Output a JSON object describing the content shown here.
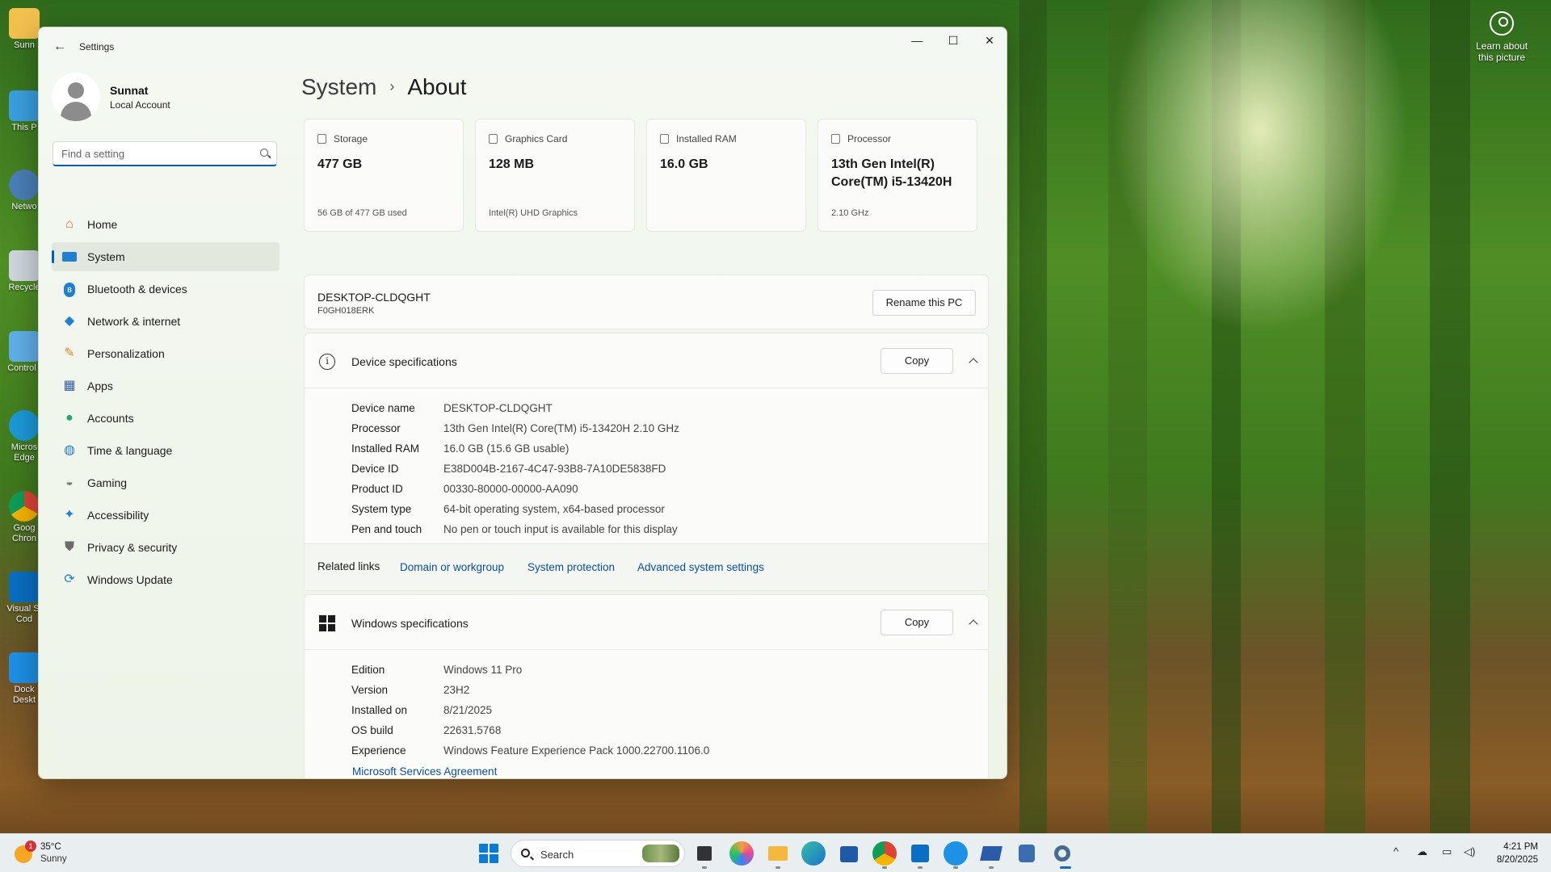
{
  "desktop": {
    "icons": [
      {
        "label": "Sunn"
      },
      {
        "label": "This P"
      },
      {
        "label": "Netwo"
      },
      {
        "label": "Recycle"
      },
      {
        "label": "Control I"
      },
      {
        "label": "Micros Edge"
      },
      {
        "label": "Goog Chron"
      },
      {
        "label": "Visual St Cod"
      },
      {
        "label": "Dock Deskt"
      }
    ],
    "learn_label": "Learn about this picture"
  },
  "window": {
    "title": "Settings",
    "minimize": "—",
    "maximize": "☐",
    "close": "✕"
  },
  "profile": {
    "name": "Sunnat",
    "account_type": "Local Account"
  },
  "search": {
    "placeholder": "Find a setting"
  },
  "nav": {
    "items": [
      {
        "label": "Home",
        "icon": "home-icon"
      },
      {
        "label": "System",
        "icon": "system-icon"
      },
      {
        "label": "Bluetooth & devices",
        "icon": "bluetooth-icon"
      },
      {
        "label": "Network & internet",
        "icon": "network-icon"
      },
      {
        "label": "Personalization",
        "icon": "brush-icon"
      },
      {
        "label": "Apps",
        "icon": "apps-icon"
      },
      {
        "label": "Accounts",
        "icon": "accounts-icon"
      },
      {
        "label": "Time & language",
        "icon": "globe-clock-icon"
      },
      {
        "label": "Gaming",
        "icon": "controller-icon"
      },
      {
        "label": "Accessibility",
        "icon": "accessibility-icon"
      },
      {
        "label": "Privacy & security",
        "icon": "shield-icon"
      },
      {
        "label": "Windows Update",
        "icon": "update-icon"
      }
    ],
    "active_index": 1
  },
  "breadcrumb": {
    "parent": "System",
    "separator": "›",
    "current": "About"
  },
  "cards": [
    {
      "label": "Storage",
      "value": "477 GB",
      "sub": "56 GB of 477 GB used"
    },
    {
      "label": "Graphics Card",
      "value": "128 MB",
      "sub": "Intel(R) UHD Graphics"
    },
    {
      "label": "Installed RAM",
      "value": "16.0 GB",
      "sub": ""
    },
    {
      "label": "Processor",
      "value": "13th Gen Intel(R) Core(TM) i5-13420H",
      "sub": "2.10 GHz"
    }
  ],
  "pc": {
    "name": "DESKTOP-CLDQGHT",
    "model": "F0GH018ERK",
    "rename_label": "Rename this PC"
  },
  "device_specs": {
    "title": "Device specifications",
    "copy_label": "Copy",
    "rows": [
      {
        "key": "Device name",
        "value": "DESKTOP-CLDQGHT"
      },
      {
        "key": "Processor",
        "value": "13th Gen Intel(R) Core(TM) i5-13420H   2.10 GHz"
      },
      {
        "key": "Installed RAM",
        "value": "16.0 GB (15.6 GB usable)"
      },
      {
        "key": "Device ID",
        "value": "E38D004B-2167-4C47-93B8-7A10DE5838FD"
      },
      {
        "key": "Product ID",
        "value": "00330-80000-00000-AA090"
      },
      {
        "key": "System type",
        "value": "64-bit operating system, x64-based processor"
      },
      {
        "key": "Pen and touch",
        "value": "No pen or touch input is available for this display"
      }
    ]
  },
  "related": {
    "label": "Related links",
    "links": [
      "Domain or workgroup",
      "System protection",
      "Advanced system settings"
    ]
  },
  "windows_specs": {
    "title": "Windows specifications",
    "copy_label": "Copy",
    "rows": [
      {
        "key": "Edition",
        "value": "Windows 11 Pro"
      },
      {
        "key": "Version",
        "value": "23H2"
      },
      {
        "key": "Installed on",
        "value": "8/21/2025"
      },
      {
        "key": "OS build",
        "value": "22631.5768"
      },
      {
        "key": "Experience",
        "value": "Windows Feature Experience Pack 1000.22700.1106.0"
      }
    ],
    "agreement_link": "Microsoft Services Agreement"
  },
  "taskbar": {
    "weather_temp": "35°C",
    "weather_cond": "Sunny",
    "weather_badge": "1",
    "search_label": "Search",
    "apps": [
      "file-explorer-icon",
      "copilot-icon",
      "folder-icon",
      "edge-icon",
      "store-icon",
      "chrome-icon",
      "vscode-icon",
      "docker-icon",
      "powershell-icon",
      "git-bash-icon",
      "settings-icon"
    ],
    "time": "4:21 PM",
    "date": "8/20/2025"
  }
}
